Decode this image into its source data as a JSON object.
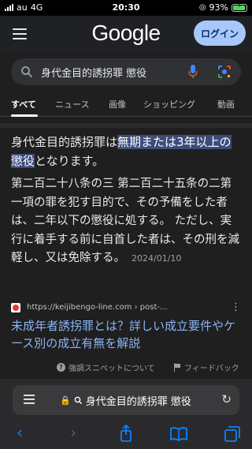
{
  "status_bar": {
    "carrier": "au",
    "network": "4G",
    "time": "20:30",
    "battery": "93%",
    "battery_level": 0.93
  },
  "header": {
    "logo": "Google",
    "login_label": "ログイン"
  },
  "search": {
    "query": "身代金目的誘拐罪 懲役"
  },
  "tabs": [
    {
      "label": "すべて",
      "active": true
    },
    {
      "label": "ニュース"
    },
    {
      "label": "画像"
    },
    {
      "label": "ショッピング"
    },
    {
      "label": "動画"
    }
  ],
  "snippet": {
    "lead_before": "身代金目的誘拐罪は",
    "lead_highlight": "無期または3年以上の懲役",
    "lead_after": "となります。",
    "body": "第二百二十八条の三 第二百二十五条の二第一項の罪を犯す目的で、その予備をした者は、二年以下の懲役に処する。 ただし、実行に着手する前に自首した者は、その刑を減軽し、又は免除する。",
    "date": "2024/01/10"
  },
  "result": {
    "source_url": "https://keijibengo-line.com › post-...",
    "title": "未成年者誘拐罪とは？詳しい成立要件やケース別の成立有無を解説"
  },
  "feedback": {
    "about_label": "強調スニペットについて",
    "feedback_label": "フィードバック"
  },
  "browser": {
    "url_text": "身代金目的誘拐罪 懲役"
  },
  "colors": {
    "accent": "#8ab4f8",
    "login_bg": "#a8c7fa",
    "ios_blue": "#0a84ff"
  }
}
